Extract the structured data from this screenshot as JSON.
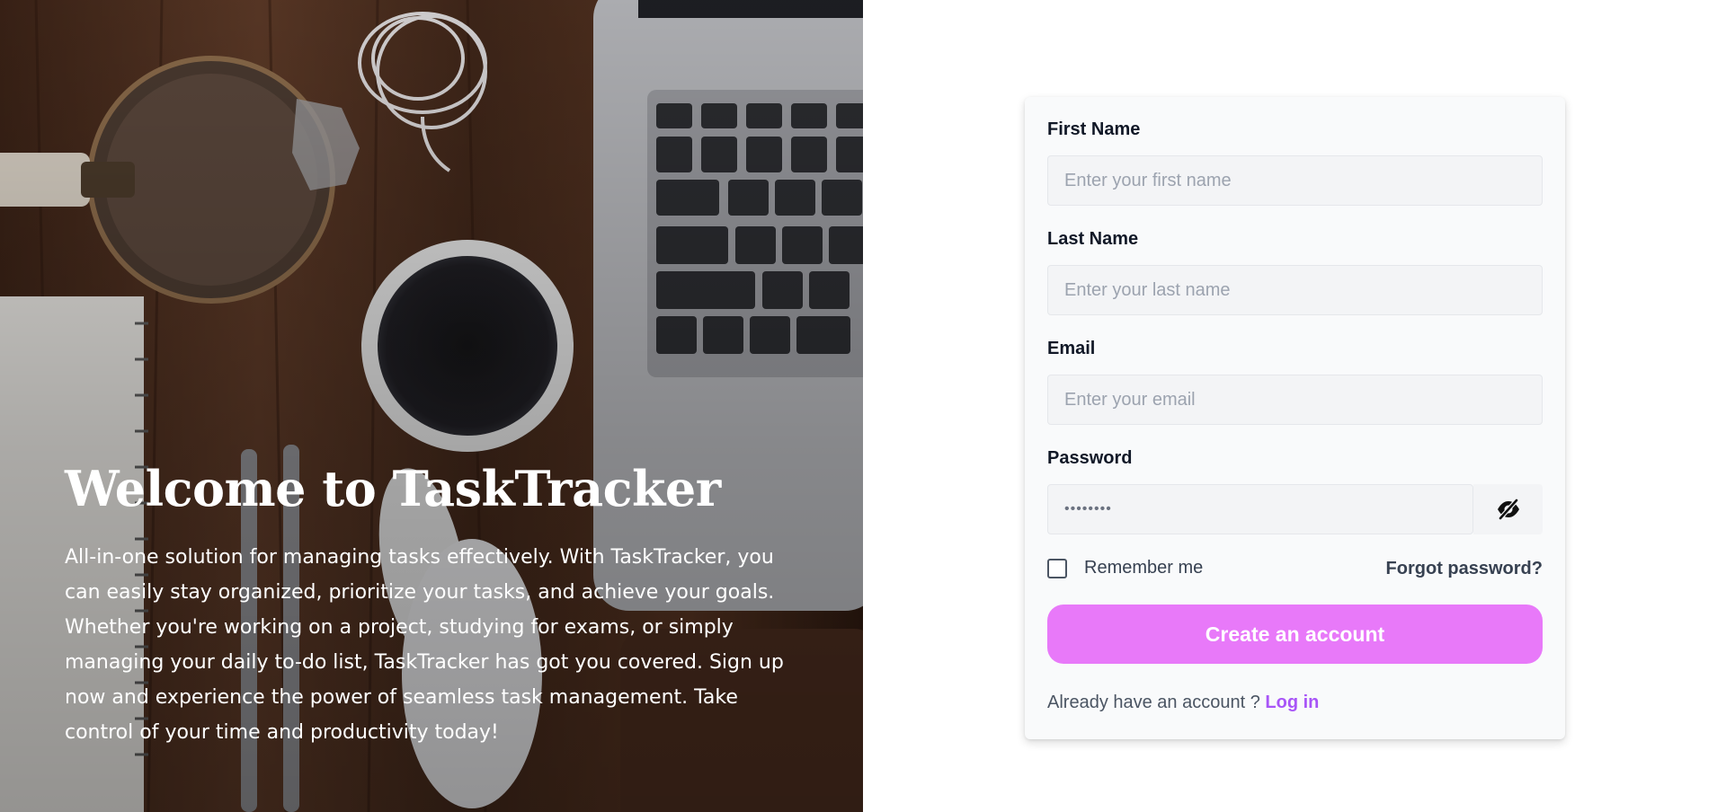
{
  "hero": {
    "title": "Welcome to TaskTracker",
    "description": "All-in-one solution for managing tasks effectively. With TaskTracker, you can easily stay organized, prioritize your tasks, and achieve your goals. Whether you're working on a project, studying for exams, or simply managing your daily to-do list, TaskTracker has got you covered. Sign up now and experience the power of seamless task management. Take control of your time and productivity today!"
  },
  "form": {
    "first_name": {
      "label": "First Name",
      "placeholder": "Enter your first name"
    },
    "last_name": {
      "label": "Last Name",
      "placeholder": "Enter your last name"
    },
    "email": {
      "label": "Email",
      "placeholder": "Enter your email"
    },
    "password": {
      "label": "Password",
      "value": "••••••••",
      "toggle_icon": "eye-slash-icon"
    },
    "remember_label": "Remember me",
    "remember_checked": false,
    "forgot_label": "Forgot password?",
    "submit_label": "Create an account",
    "login_prompt": "Already have an account ?",
    "login_link": "Log in"
  },
  "colors": {
    "primary_button": "#e879f9",
    "link": "#a855f7",
    "card_background": "#f9fafb",
    "input_background": "#f3f4f6"
  }
}
